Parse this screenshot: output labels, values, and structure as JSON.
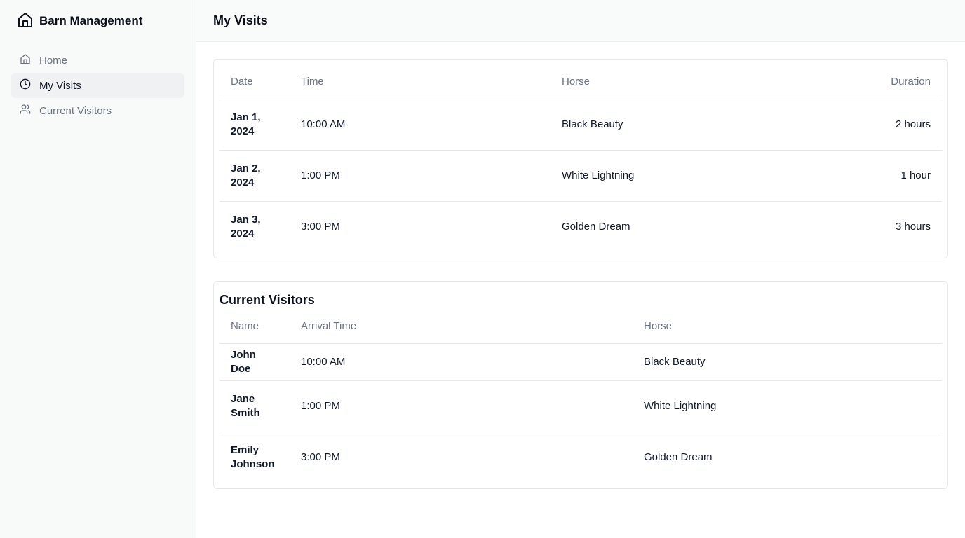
{
  "sidebar": {
    "brand": "Barn Management",
    "items": [
      {
        "label": "Home",
        "icon": "home-icon"
      },
      {
        "label": "My Visits",
        "icon": "clock-icon"
      },
      {
        "label": "Current Visitors",
        "icon": "users-icon"
      }
    ]
  },
  "header": {
    "title": "My Visits"
  },
  "visits": {
    "columns": [
      "Date",
      "Time",
      "Horse",
      "Duration"
    ],
    "rows": [
      {
        "date": "Jan 1, 2024",
        "time": "10:00 AM",
        "horse": "Black Beauty",
        "duration": "2 hours"
      },
      {
        "date": "Jan 2, 2024",
        "time": "1:00 PM",
        "horse": "White Lightning",
        "duration": "1 hour"
      },
      {
        "date": "Jan 3, 2024",
        "time": "3:00 PM",
        "horse": "Golden Dream",
        "duration": "3 hours"
      }
    ]
  },
  "visitors": {
    "title": "Current Visitors",
    "columns": [
      "Name",
      "Arrival Time",
      "Horse"
    ],
    "rows": [
      {
        "name": "John Doe",
        "arrival": "10:00 AM",
        "horse": "Black Beauty"
      },
      {
        "name": "Jane Smith",
        "arrival": "1:00 PM",
        "horse": "White Lightning"
      },
      {
        "name": "Emily Johnson",
        "arrival": "3:00 PM",
        "horse": "Golden Dream"
      }
    ]
  }
}
